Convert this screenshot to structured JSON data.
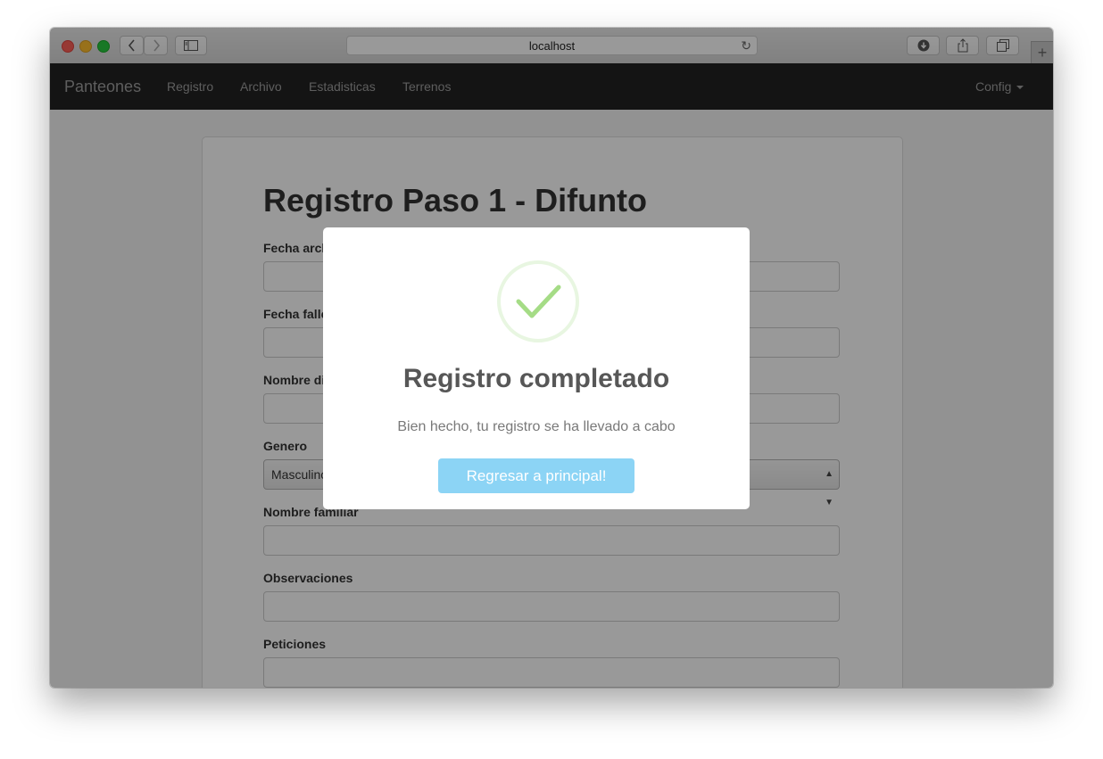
{
  "browser": {
    "url": "localhost",
    "icons": {
      "back": "chevron-left-icon",
      "forward": "chevron-right-icon",
      "sidebar": "sidebar-icon",
      "reload": "reload-icon",
      "downloads": "download-icon",
      "share": "share-icon",
      "tabs": "tabs-icon",
      "new_tab": "plus-icon"
    }
  },
  "navbar": {
    "brand": "Panteones",
    "links": [
      "Registro",
      "Archivo",
      "Estadisticas",
      "Terrenos"
    ],
    "config": "Config"
  },
  "form": {
    "title": "Registro Paso 1 - Difunto",
    "fields": [
      {
        "label": "Fecha archivo",
        "value": ""
      },
      {
        "label": "Fecha fallecimiento",
        "value": ""
      },
      {
        "label": "Nombre difunto",
        "value": ""
      },
      {
        "label": "Genero",
        "value": "Masculino"
      },
      {
        "label": "Nombre familiar",
        "value": ""
      },
      {
        "label": "Observaciones",
        "value": ""
      },
      {
        "label": "Peticiones",
        "value": ""
      }
    ]
  },
  "modal": {
    "icon": "success-check-icon",
    "title": "Registro completado",
    "text": "Bien hecho, tu registro se ha llevado a cabo",
    "confirm_label": "Regresar a principal!"
  },
  "colors": {
    "navbar_bg": "#222222",
    "success_green": "#A5DC86",
    "confirm_button": "#8CD4F5"
  }
}
